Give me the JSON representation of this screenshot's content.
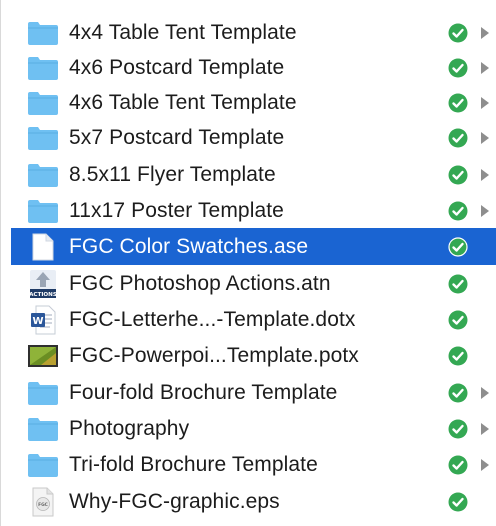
{
  "colors": {
    "selection": "#1a64d2",
    "sync_ok": "#34a853",
    "folder": "#6fc0f2",
    "chevron": "#8e8e8e"
  },
  "items": [
    {
      "name": "4x4 Table Tent Template",
      "kind": "folder",
      "icon": "folder-icon",
      "status": "synced-checkmark-icon",
      "expandable": true
    },
    {
      "name": "4x6 Postcard Template",
      "kind": "folder",
      "icon": "folder-icon",
      "status": "synced-checkmark-icon",
      "expandable": true
    },
    {
      "name": "4x6 Table Tent Template",
      "kind": "folder",
      "icon": "folder-icon",
      "status": "synced-checkmark-icon",
      "expandable": true
    },
    {
      "name": "5x7 Postcard Template",
      "kind": "folder",
      "icon": "folder-icon",
      "status": "synced-checkmark-icon",
      "expandable": true
    },
    {
      "name": "8.5x11 Flyer Template",
      "kind": "folder",
      "icon": "folder-icon",
      "status": "synced-checkmark-icon",
      "expandable": true
    },
    {
      "name": "11x17 Poster Template",
      "kind": "folder",
      "icon": "folder-icon",
      "status": "synced-checkmark-icon",
      "expandable": true
    },
    {
      "name": "FGC Color Swatches.ase",
      "kind": "document",
      "icon": "blank-document-icon",
      "status": "synced-checkmark-icon",
      "expandable": false,
      "selected": true
    },
    {
      "name": "FGC Photoshop Actions.atn",
      "kind": "actions",
      "icon": "photoshop-actions-icon",
      "icon_label": "ACTIONS",
      "status": "synced-checkmark-icon",
      "expandable": false
    },
    {
      "name": "FGC-Letterhe...-Template.dotx",
      "kind": "word",
      "icon": "word-document-icon",
      "icon_label": "W",
      "status": "synced-checkmark-icon",
      "expandable": false
    },
    {
      "name": "FGC-Powerpoi...Template.potx",
      "kind": "powerpoint",
      "icon": "powerpoint-template-icon",
      "status": "synced-checkmark-icon",
      "expandable": false
    },
    {
      "name": "Four-fold Brochure Template",
      "kind": "folder",
      "icon": "folder-icon",
      "status": "synced-checkmark-icon",
      "expandable": true
    },
    {
      "name": "Photography",
      "kind": "folder",
      "icon": "folder-icon",
      "status": "synced-checkmark-icon",
      "expandable": true
    },
    {
      "name": "Tri-fold Brochure Template",
      "kind": "folder",
      "icon": "folder-icon",
      "status": "synced-checkmark-icon",
      "expandable": true
    },
    {
      "name": "Why-FGC-graphic.eps",
      "kind": "eps",
      "icon": "eps-document-icon",
      "icon_label": "FGC",
      "status": "synced-checkmark-icon",
      "expandable": false
    }
  ]
}
